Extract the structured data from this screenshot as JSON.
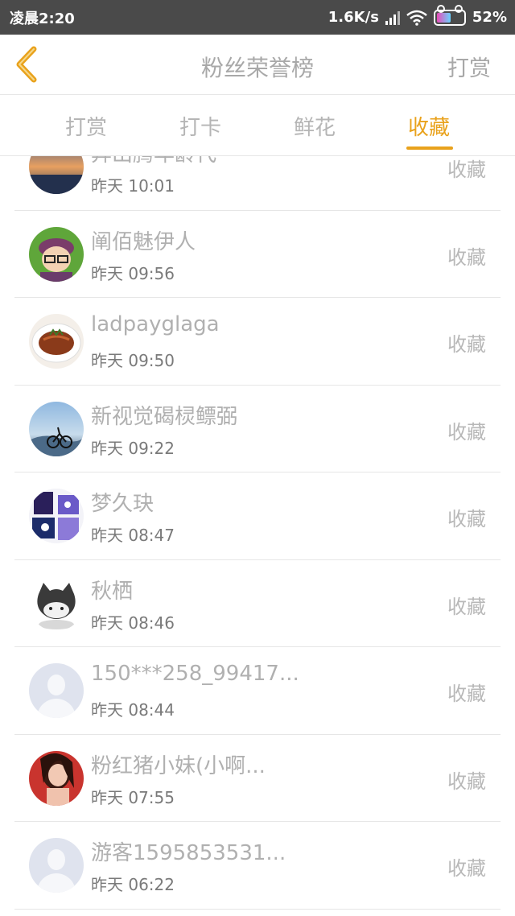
{
  "status_bar": {
    "time": "凌晨2:20",
    "network_speed": "1.6K/s",
    "battery_percent": "52%",
    "battery_level": 0.52
  },
  "nav": {
    "title": "粉丝荣誉榜",
    "action_label": "打赏"
  },
  "tabs": [
    {
      "label": "打赏",
      "active": false
    },
    {
      "label": "打卡",
      "active": false
    },
    {
      "label": "鲜花",
      "active": false
    },
    {
      "label": "收藏",
      "active": true
    }
  ],
  "rows": [
    {
      "name": "异出腾年龄代",
      "time": "昨天 10:01",
      "action": "收藏"
    },
    {
      "name": "阐佰魅伊人",
      "time": "昨天 09:56",
      "action": "收藏"
    },
    {
      "name": "ladpayglaga",
      "time": "昨天 09:50",
      "action": "收藏"
    },
    {
      "name": "新视觉碣棂鳔弼",
      "time": "昨天 09:22",
      "action": "收藏"
    },
    {
      "name": "梦久玦",
      "time": "昨天 08:47",
      "action": "收藏"
    },
    {
      "name": "秋栖",
      "time": "昨天 08:46",
      "action": "收藏"
    },
    {
      "name": "150***258_99417...",
      "time": "昨天 08:44",
      "action": "收藏"
    },
    {
      "name": "粉红猪小妹(小啊...",
      "time": "昨天 07:55",
      "action": "收藏"
    },
    {
      "name": "游客1595853531...",
      "time": "昨天 06:22",
      "action": "收藏"
    }
  ],
  "colors": {
    "accent": "#e9a21c",
    "status_bar_bg": "#4a4a4a",
    "text_muted": "#b0b0b0"
  }
}
